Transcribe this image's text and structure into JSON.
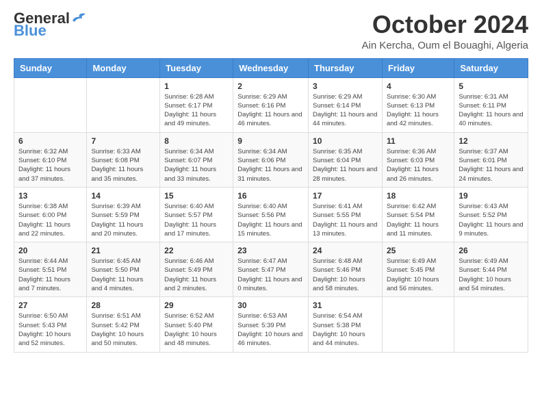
{
  "logo": {
    "general": "General",
    "blue": "Blue"
  },
  "header": {
    "month": "October 2024",
    "location": "Ain Kercha, Oum el Bouaghi, Algeria"
  },
  "weekdays": [
    "Sunday",
    "Monday",
    "Tuesday",
    "Wednesday",
    "Thursday",
    "Friday",
    "Saturday"
  ],
  "weeks": [
    [
      {
        "day": "",
        "info": ""
      },
      {
        "day": "",
        "info": ""
      },
      {
        "day": "1",
        "info": "Sunrise: 6:28 AM\nSunset: 6:17 PM\nDaylight: 11 hours and 49 minutes."
      },
      {
        "day": "2",
        "info": "Sunrise: 6:29 AM\nSunset: 6:16 PM\nDaylight: 11 hours and 46 minutes."
      },
      {
        "day": "3",
        "info": "Sunrise: 6:29 AM\nSunset: 6:14 PM\nDaylight: 11 hours and 44 minutes."
      },
      {
        "day": "4",
        "info": "Sunrise: 6:30 AM\nSunset: 6:13 PM\nDaylight: 11 hours and 42 minutes."
      },
      {
        "day": "5",
        "info": "Sunrise: 6:31 AM\nSunset: 6:11 PM\nDaylight: 11 hours and 40 minutes."
      }
    ],
    [
      {
        "day": "6",
        "info": "Sunrise: 6:32 AM\nSunset: 6:10 PM\nDaylight: 11 hours and 37 minutes."
      },
      {
        "day": "7",
        "info": "Sunrise: 6:33 AM\nSunset: 6:08 PM\nDaylight: 11 hours and 35 minutes."
      },
      {
        "day": "8",
        "info": "Sunrise: 6:34 AM\nSunset: 6:07 PM\nDaylight: 11 hours and 33 minutes."
      },
      {
        "day": "9",
        "info": "Sunrise: 6:34 AM\nSunset: 6:06 PM\nDaylight: 11 hours and 31 minutes."
      },
      {
        "day": "10",
        "info": "Sunrise: 6:35 AM\nSunset: 6:04 PM\nDaylight: 11 hours and 28 minutes."
      },
      {
        "day": "11",
        "info": "Sunrise: 6:36 AM\nSunset: 6:03 PM\nDaylight: 11 hours and 26 minutes."
      },
      {
        "day": "12",
        "info": "Sunrise: 6:37 AM\nSunset: 6:01 PM\nDaylight: 11 hours and 24 minutes."
      }
    ],
    [
      {
        "day": "13",
        "info": "Sunrise: 6:38 AM\nSunset: 6:00 PM\nDaylight: 11 hours and 22 minutes."
      },
      {
        "day": "14",
        "info": "Sunrise: 6:39 AM\nSunset: 5:59 PM\nDaylight: 11 hours and 20 minutes."
      },
      {
        "day": "15",
        "info": "Sunrise: 6:40 AM\nSunset: 5:57 PM\nDaylight: 11 hours and 17 minutes."
      },
      {
        "day": "16",
        "info": "Sunrise: 6:40 AM\nSunset: 5:56 PM\nDaylight: 11 hours and 15 minutes."
      },
      {
        "day": "17",
        "info": "Sunrise: 6:41 AM\nSunset: 5:55 PM\nDaylight: 11 hours and 13 minutes."
      },
      {
        "day": "18",
        "info": "Sunrise: 6:42 AM\nSunset: 5:54 PM\nDaylight: 11 hours and 11 minutes."
      },
      {
        "day": "19",
        "info": "Sunrise: 6:43 AM\nSunset: 5:52 PM\nDaylight: 11 hours and 9 minutes."
      }
    ],
    [
      {
        "day": "20",
        "info": "Sunrise: 6:44 AM\nSunset: 5:51 PM\nDaylight: 11 hours and 7 minutes."
      },
      {
        "day": "21",
        "info": "Sunrise: 6:45 AM\nSunset: 5:50 PM\nDaylight: 11 hours and 4 minutes."
      },
      {
        "day": "22",
        "info": "Sunrise: 6:46 AM\nSunset: 5:49 PM\nDaylight: 11 hours and 2 minutes."
      },
      {
        "day": "23",
        "info": "Sunrise: 6:47 AM\nSunset: 5:47 PM\nDaylight: 11 hours and 0 minutes."
      },
      {
        "day": "24",
        "info": "Sunrise: 6:48 AM\nSunset: 5:46 PM\nDaylight: 10 hours and 58 minutes."
      },
      {
        "day": "25",
        "info": "Sunrise: 6:49 AM\nSunset: 5:45 PM\nDaylight: 10 hours and 56 minutes."
      },
      {
        "day": "26",
        "info": "Sunrise: 6:49 AM\nSunset: 5:44 PM\nDaylight: 10 hours and 54 minutes."
      }
    ],
    [
      {
        "day": "27",
        "info": "Sunrise: 6:50 AM\nSunset: 5:43 PM\nDaylight: 10 hours and 52 minutes."
      },
      {
        "day": "28",
        "info": "Sunrise: 6:51 AM\nSunset: 5:42 PM\nDaylight: 10 hours and 50 minutes."
      },
      {
        "day": "29",
        "info": "Sunrise: 6:52 AM\nSunset: 5:40 PM\nDaylight: 10 hours and 48 minutes."
      },
      {
        "day": "30",
        "info": "Sunrise: 6:53 AM\nSunset: 5:39 PM\nDaylight: 10 hours and 46 minutes."
      },
      {
        "day": "31",
        "info": "Sunrise: 6:54 AM\nSunset: 5:38 PM\nDaylight: 10 hours and 44 minutes."
      },
      {
        "day": "",
        "info": ""
      },
      {
        "day": "",
        "info": ""
      }
    ]
  ]
}
